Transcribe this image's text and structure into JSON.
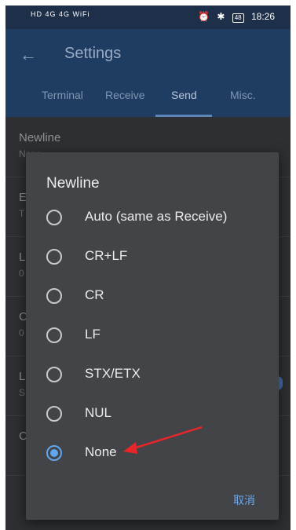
{
  "status_bar": {
    "left_indicators": "HD 4G 4G WiFi",
    "battery": "48",
    "time": "18:26"
  },
  "app_bar": {
    "title": "Settings",
    "tabs": [
      {
        "label": "Terminal",
        "active": false
      },
      {
        "label": "Receive",
        "active": false
      },
      {
        "label": "Send",
        "active": true
      },
      {
        "label": "Misc.",
        "active": false
      }
    ]
  },
  "background_list": {
    "items": [
      {
        "title": "Newline",
        "subtitle": "None"
      },
      {
        "title": "E",
        "subtitle": "T"
      },
      {
        "title": "L",
        "subtitle": "0"
      },
      {
        "title": "C",
        "subtitle": "0"
      },
      {
        "title": "L",
        "subtitle": "S"
      },
      {
        "title": "C",
        "subtitle": ""
      }
    ]
  },
  "dialog": {
    "title": "Newline",
    "options": [
      {
        "label": "Auto (same as Receive)",
        "selected": false
      },
      {
        "label": "CR+LF",
        "selected": false
      },
      {
        "label": "CR",
        "selected": false
      },
      {
        "label": "LF",
        "selected": false
      },
      {
        "label": "STX/ETX",
        "selected": false
      },
      {
        "label": "NUL",
        "selected": false
      },
      {
        "label": "None",
        "selected": true
      }
    ],
    "cancel_label": "取消"
  },
  "colors": {
    "app_bar": "#1f3d63",
    "dialog_bg": "#424447",
    "accent": "#5fa6ef",
    "annotation_arrow": "#e8262a"
  }
}
